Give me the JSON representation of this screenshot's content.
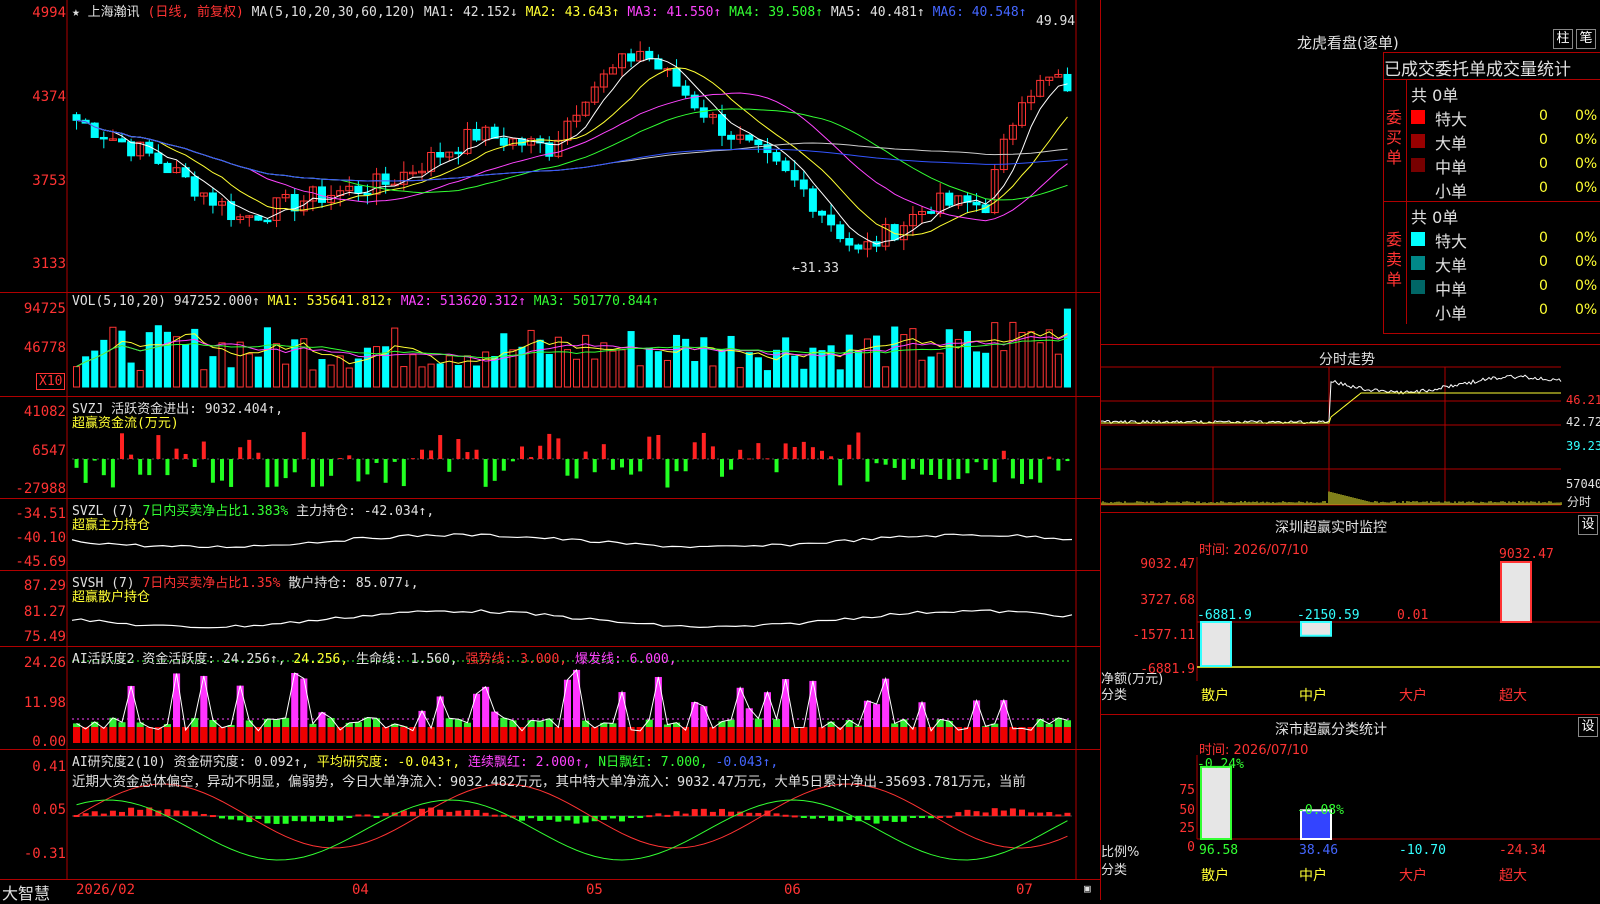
{
  "stock": {
    "title": "上海瀚讯",
    "period": "(日线, 前复权)"
  },
  "main": {
    "ma_header": "MA(5,10,20,30,60,120)",
    "ma1": "MA1: 42.152↓",
    "ma2": "MA2: 43.643↑",
    "ma3": "MA3: 41.550↑",
    "ma4": "MA4: 39.508↑",
    "ma5": "MA5: 40.481↑",
    "ma6": "MA6: 40.548↑",
    "yaxis": [
      "4994",
      "4374",
      "3753",
      "3133"
    ],
    "high_label": "49.94",
    "low_label": "←31.33"
  },
  "vol": {
    "header": "VOL(5,10,20)",
    "value": "947252.000↑",
    "ma1": "MA1: 535641.812↑",
    "ma2": "MA2: 513620.312↑",
    "ma3": "MA3: 501770.844↑",
    "yaxis": [
      "94725",
      "46778"
    ],
    "unit": "X10"
  },
  "svzj": {
    "header": "SVZJ  活跃资金进出: 9032.404↑,",
    "sub": "超赢资金流(万元)",
    "yaxis": [
      "41082",
      "6547",
      "-27988"
    ]
  },
  "svzl": {
    "header1": "SVZL (7) ",
    "header2": "7日内买卖净占比1.383%",
    "header3": " 主力持仓: -42.034↑,",
    "sub": "超赢主力持仓",
    "yaxis": [
      "-34.51",
      "-40.10",
      "-45.69"
    ]
  },
  "svsh": {
    "header1": "SVSH (7) ",
    "header2": "7日内买卖净占比1.35%",
    "header3": " 散户持仓: 85.077↓,",
    "sub": "超赢散户持仓",
    "yaxis": [
      "87.29",
      "81.27",
      "75.49"
    ]
  },
  "ai1": {
    "header": "AI活跃度2 资金活跃度: 24.256↑, ",
    "v2": "24.256,",
    "v3": " 生命线: 1.560, ",
    "v4": "强势线: 3.000, ",
    "v5": "爆发线: 6.000,",
    "yaxis": [
      "24.26",
      "11.98",
      "0.00"
    ]
  },
  "ai2": {
    "header": "AI研究度2(10) 资金研究度: 0.092↑, ",
    "v2": "平均研究度: -0.043↑, ",
    "v3": "连续飘红: 2.000↑, ",
    "v4": "N日飘红: 7.000, ",
    "v5": "-0.043↑,",
    "text": "近期大资金总体偏空，异动不明显，偏弱势，今日大单净流入：9032.482万元，其中特大单净流入：9032.47万元，大单5日累计净出-35693.781万元，当前",
    "yaxis": [
      "0.41",
      "0.05",
      "-0.31"
    ]
  },
  "xaxis": [
    "2026/02",
    "04",
    "05",
    "06",
    "07"
  ],
  "brand": "大智慧",
  "right": {
    "lhb_title": "龙虎看盘(逐单)",
    "btn_zhu": "柱",
    "btn_bi": "笔",
    "tabs_header": "已成交委托单成交量统计",
    "buy_label": "委买单",
    "sell_label": "委卖单",
    "buy_total": "共 0单",
    "sell_total": "共 0单",
    "buy_rows": [
      {
        "name": "特大",
        "count": "0",
        "pct": "0%",
        "color": "#ff0000"
      },
      {
        "name": "大单",
        "count": "0",
        "pct": "0%",
        "color": "#990000"
      },
      {
        "name": "中单",
        "count": "0",
        "pct": "0%",
        "color": "#770000"
      },
      {
        "name": "小单",
        "count": "0",
        "pct": "0%",
        "color": ""
      }
    ],
    "sell_rows": [
      {
        "name": "特大",
        "count": "0",
        "pct": "0%",
        "color": "#00ffff"
      },
      {
        "name": "大单",
        "count": "0",
        "pct": "0%",
        "color": "#008888"
      },
      {
        "name": "中单",
        "count": "0",
        "pct": "0%",
        "color": "#006666"
      },
      {
        "name": "小单",
        "count": "0",
        "pct": "0%",
        "color": ""
      }
    ],
    "fs_title": "分时走势",
    "fs_yaxis": [
      "46.21",
      "42.72",
      "39.23",
      "57040"
    ],
    "fs_unit": "分时",
    "sz_title": "深圳超赢实时监控",
    "sz_btn": "设",
    "sz_time": "时间: 2026/07/10",
    "sz_yaxis": [
      "9032.47",
      "3727.68",
      "-1577.11",
      "-6881.9"
    ],
    "sz_bars": [
      {
        "cat": "散户",
        "label": "-6881.9",
        "value": -6881.9
      },
      {
        "cat": "中户",
        "label": "-2150.59",
        "value": -2150.59
      },
      {
        "cat": "大户",
        "label": "0.01",
        "value": 0.01
      },
      {
        "cat": "超大",
        "label": "9032.47",
        "value": 9032.47
      }
    ],
    "sz_axis1": "净额(万元)",
    "sz_axis2": "分类",
    "ss_title": "深市超赢分类统计",
    "ss_btn": "设",
    "ss_time": "时间: 2026/07/10",
    "ss_yaxis": [
      "75",
      "50",
      "25",
      "0"
    ],
    "ss_top": [
      {
        "label": "-0.24%",
        "value": -0.24
      },
      {
        "label": "-0.08%",
        "value": -0.08
      }
    ],
    "ss_bottom": [
      "96.58",
      "38.46",
      "-10.70",
      "-24.34"
    ],
    "ss_bar_values": [
      96.58,
      38.46
    ],
    "ss_cats": [
      "散户",
      "中户",
      "大户",
      "超大"
    ],
    "ss_axis1": "比例%",
    "ss_axis2": "分类"
  },
  "colors": {
    "up": "#ff3333",
    "down": "#00ffff",
    "grid": "#b00000"
  }
}
